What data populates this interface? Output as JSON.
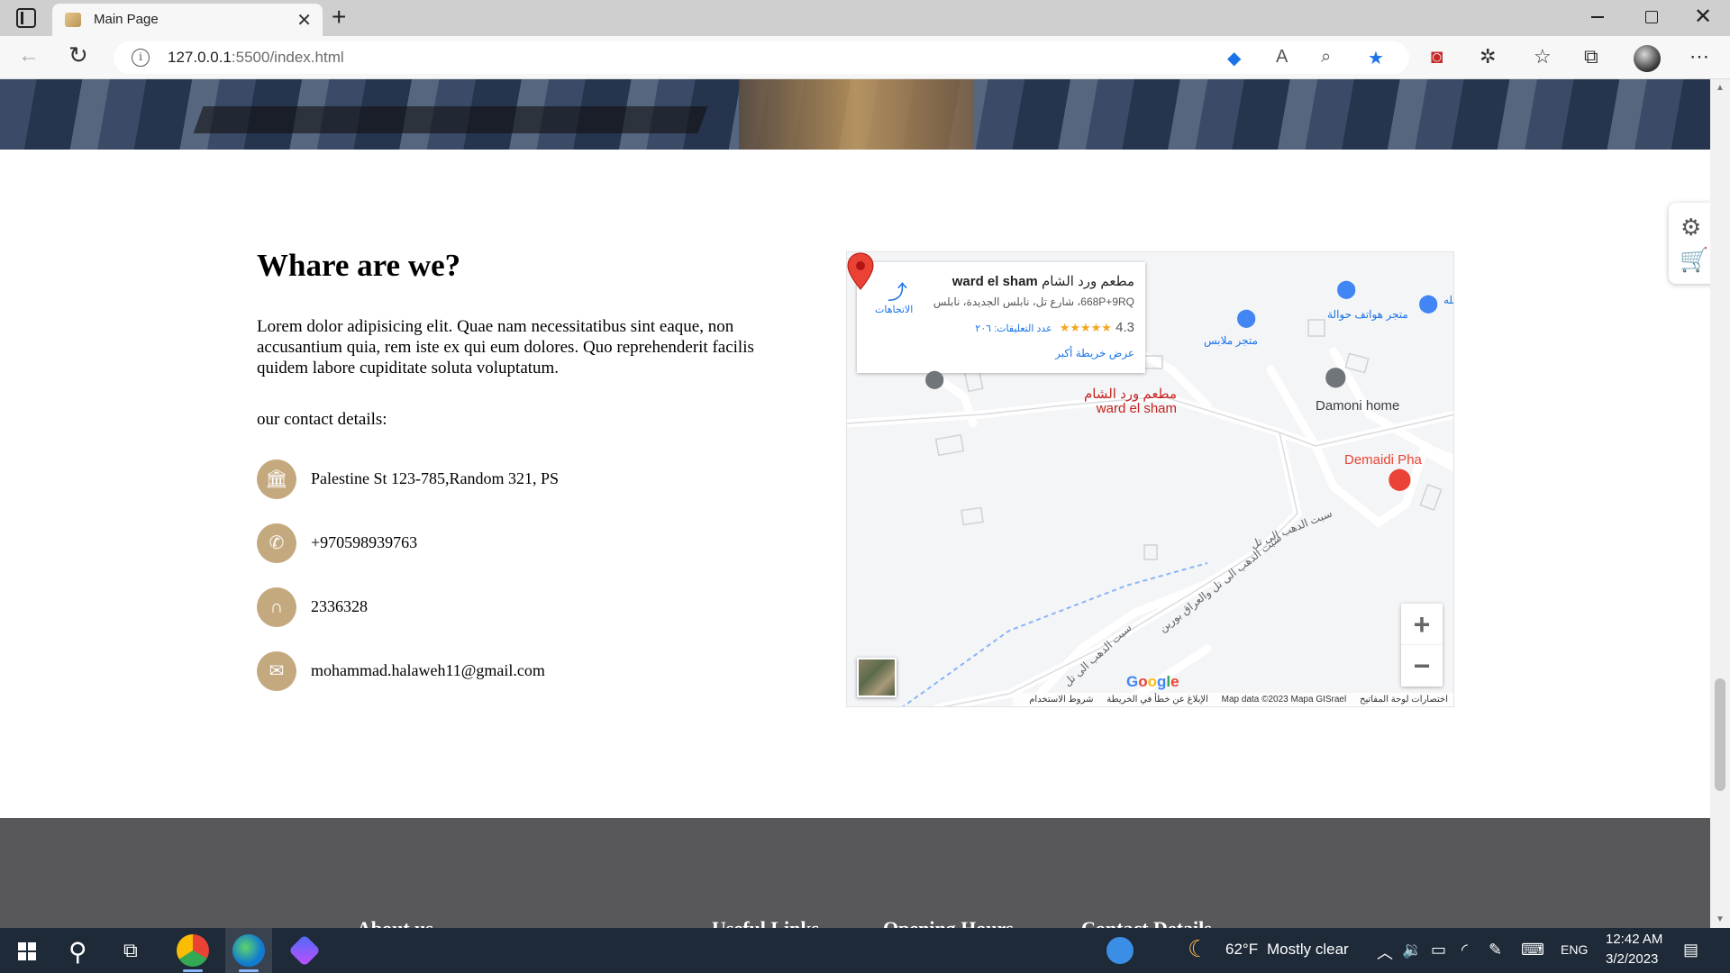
{
  "browser": {
    "tab_title": "Main Page",
    "url_host": "127.0.0.1",
    "url_path": ":5500/index.html",
    "new_tab_symbol": "+",
    "close_symbol": "✕"
  },
  "section": {
    "title": "Whare are we?",
    "description": "Lorem dolor adipisicing elit. Quae nam necessitatibus sint eaque, non accusantium quia, rem iste ex qui eum dolores. Quo reprehenderit facilis quidem labore cupiditate soluta voluptatum.",
    "contact_heading": "our contact details:",
    "contacts": [
      {
        "icon": "bank-icon",
        "text": "Palestine St 123-785,Random 321, PS"
      },
      {
        "icon": "phone-icon",
        "text": "+970598939763"
      },
      {
        "icon": "headphones-icon",
        "text": "2336328"
      },
      {
        "icon": "envelope-icon",
        "text": "mohammad.halaweh11@gmail.com"
      }
    ]
  },
  "map": {
    "card_name_ar": "مطعم ورد الشام",
    "card_name_en": "ward el sham",
    "card_address": "668P+9RQ، شارع تل، نابلس الجديدة، نابلس",
    "rating": "4.3",
    "stars": "★★★★★",
    "reviews": "عدد التعليقات: ٢٠٦",
    "view_larger": "عرض خريطة أكبر",
    "directions": "الاتجاهات",
    "pin_label_ar": "مطعم ورد الشام",
    "pin_label_en": "ward el sham",
    "poi_damoni": "Damoni home",
    "poi_demaidi": "Demaidi Pha",
    "poi_phones": "متجر هواتف حوالة",
    "poi_clothes": "متجر ملابس",
    "poi_edge": "الله",
    "road_label_1": "سبت الدهب الى تل",
    "road_label_2": "سبت الدهب الى تل والعراق بورين",
    "road_label_3": "سبت الدهب الى تل",
    "google": "Google",
    "footer": {
      "shortcuts": "اختصارات لوحة المفاتيح",
      "data": "Map data ©2023 Mapa GISrael",
      "terms": "شروط الاستخدام",
      "report": "الإبلاغ عن خطأ في الخريطة"
    },
    "zoom_in": "+",
    "zoom_out": "−"
  },
  "footer": {
    "headings": [
      "About us",
      "Useful Links",
      "Opening Hours",
      "Contact Details"
    ]
  },
  "taskbar": {
    "weather_temp": "62°F",
    "weather_desc": "Mostly clear",
    "language": "ENG",
    "time": "12:42 AM",
    "date": "3/2/2023"
  },
  "colors": {
    "contact_icon_bg": "#c4a97f",
    "footer_bg": "#58585a",
    "taskbar_bg": "#1e2a38",
    "map_pin": "#ea4335"
  }
}
